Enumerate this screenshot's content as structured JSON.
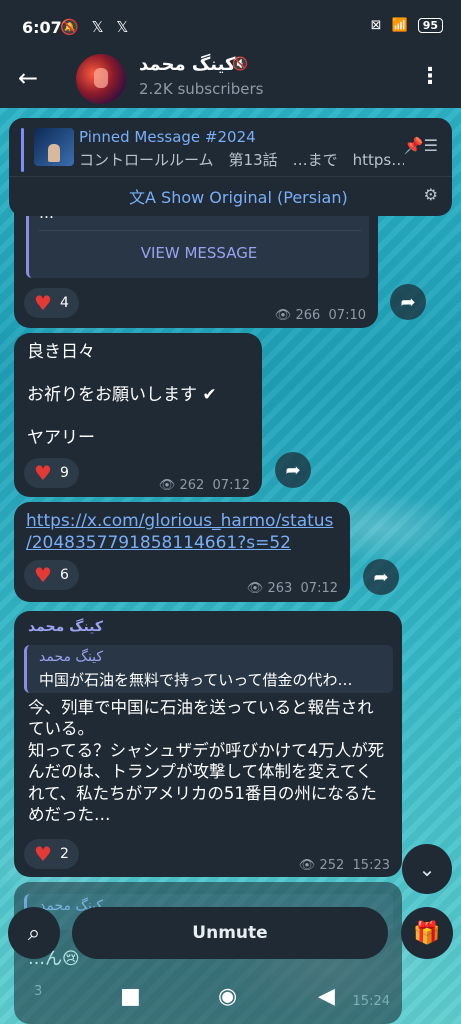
{
  "status": {
    "time": "6:07",
    "left_icons": "🔕 𝕏 𝕏",
    "battery": "95"
  },
  "header": {
    "channel_name": "كينگ محمد",
    "subscribers": "2.2K subscribers"
  },
  "pinned": {
    "title": "Pinned Message #2024",
    "text": "コントロールルーム　第13話　…まで　https…",
    "translate_label": "Show Original (Persian)"
  },
  "msg1": {
    "ellipsis": "…",
    "view_button": "VIEW MESSAGE",
    "reaction_count": "4",
    "views": "266",
    "time": "07:10"
  },
  "msg2": {
    "line1": "良き日々",
    "line2": "お祈りをお願いします ✔",
    "line3": "ヤアリー",
    "reaction_count": "9",
    "views": "262",
    "time": "07:12"
  },
  "msg3": {
    "link_line1": "https://x.com/glorious_harmo/status",
    "link_line2": "/2048357791858114661?s=52",
    "reaction_count": "6",
    "views": "263",
    "time": "07:12"
  },
  "msg4": {
    "author": "كينگ محمد",
    "quote_name": "كينگ محمد",
    "quote_text": "中国が石油を無料で持っていって借金の代わ…",
    "body": "今、列車で中国に石油を送っていると報告されている。\n知ってる？シャシュザデが呼びかけて4万人が死んだのは、トランプが攻撃して体制を変えてくれて、私たちがアメリカの51番目の州になるためだった…",
    "reaction_count": "2",
    "views": "252",
    "time": "15:23"
  },
  "msg5": {
    "author": "كينگ محمد",
    "partial_text": "…ん😢",
    "reaction_count": "3",
    "time": "15:24"
  },
  "bottom": {
    "unmute_label": "Unmute"
  },
  "icons": {
    "back": "arrow-left",
    "menu": "more-vertical",
    "search": "search",
    "gift": "gift",
    "down": "chevron-down",
    "share": "share-arrow"
  }
}
